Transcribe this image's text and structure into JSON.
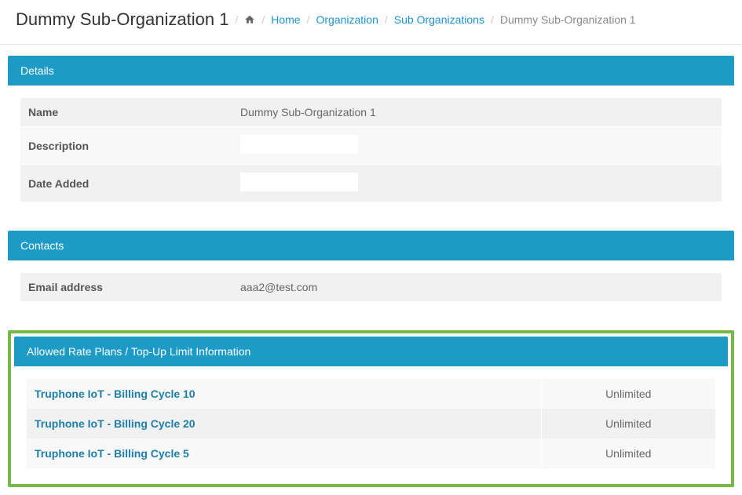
{
  "page": {
    "title": "Dummy Sub-Organization 1"
  },
  "breadcrumb": {
    "home": "Home",
    "organization": "Organization",
    "subOrganizations": "Sub Organizations",
    "current": "Dummy Sub-Organization 1"
  },
  "panels": {
    "details": {
      "header": "Details",
      "rows": {
        "name": {
          "label": "Name",
          "value": "Dummy Sub-Organization 1"
        },
        "description": {
          "label": "Description",
          "value": ""
        },
        "dateAdded": {
          "label": "Date Added",
          "value": ""
        }
      }
    },
    "contacts": {
      "header": "Contacts",
      "rows": {
        "email": {
          "label": "Email address",
          "value": "aaa2@test.com"
        }
      }
    },
    "ratePlans": {
      "header": "Allowed Rate Plans / Top-Up Limit Information",
      "items": [
        {
          "plan": "Truphone IoT - Billing Cycle 10",
          "limit": "Unlimited"
        },
        {
          "plan": "Truphone IoT - Billing Cycle 20",
          "limit": "Unlimited"
        },
        {
          "plan": "Truphone IoT - Billing Cycle 5",
          "limit": "Unlimited"
        }
      ]
    }
  }
}
